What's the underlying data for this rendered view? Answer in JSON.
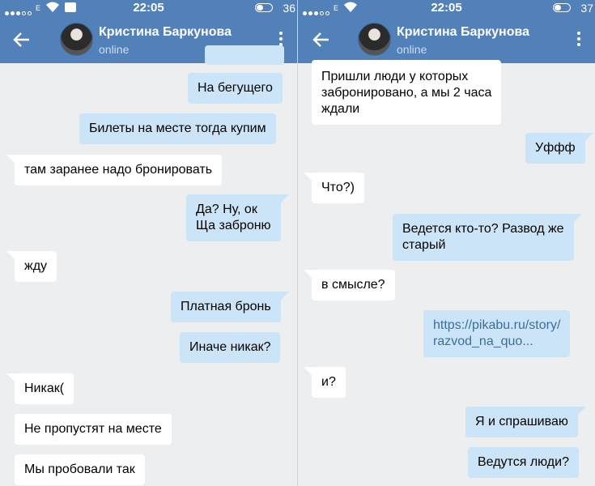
{
  "status_bar": {
    "carrier": "E",
    "time": "22:05",
    "battery_left": "36",
    "battery_right": "37"
  },
  "header": {
    "contact_name": "Кристина Баркунова",
    "presence": "online"
  },
  "left_chat": {
    "messages": [
      {
        "from": "me",
        "text": "На бегущего"
      },
      {
        "from": "me",
        "text": "Билеты на месте тогда купим"
      },
      {
        "from": "them",
        "text": "там заранее надо бронировать"
      },
      {
        "from": "me",
        "lines": [
          "Да? Ну, ок",
          "Ща заброню"
        ]
      },
      {
        "from": "them",
        "text": "жду"
      },
      {
        "from": "me",
        "text": "Платная бронь"
      },
      {
        "from": "me",
        "text": "Иначе никак?"
      },
      {
        "from": "them",
        "text": "Никак("
      },
      {
        "from": "them",
        "text": "Не пропустят на месте"
      },
      {
        "from": "them",
        "text": "Мы пробовали так"
      }
    ]
  },
  "right_chat": {
    "messages": [
      {
        "from": "them",
        "lines": [
          "Пришли люди у которых",
          "забронировано, а мы 2 часа",
          "ждали"
        ]
      },
      {
        "from": "me",
        "text": "Уффф"
      },
      {
        "from": "them",
        "text": "Что?)"
      },
      {
        "from": "me",
        "lines": [
          "Ведется кто-то? Развод же",
          "старый"
        ]
      },
      {
        "from": "them",
        "text": "в смысле?"
      },
      {
        "from": "me",
        "lines": [
          "https://pikabu.ru/story/",
          "razvod_na_quo..."
        ],
        "is_link": true
      },
      {
        "from": "them",
        "text": "и?"
      },
      {
        "from": "me",
        "text": "Я и спрашиваю"
      },
      {
        "from": "me",
        "text": "Ведутся люди?"
      }
    ]
  },
  "colors": {
    "header": "#5181b8",
    "background": "#edeef0",
    "bubble_in": "#ffffff",
    "bubble_out": "#cce4f7",
    "link": "#3e6e9f"
  }
}
